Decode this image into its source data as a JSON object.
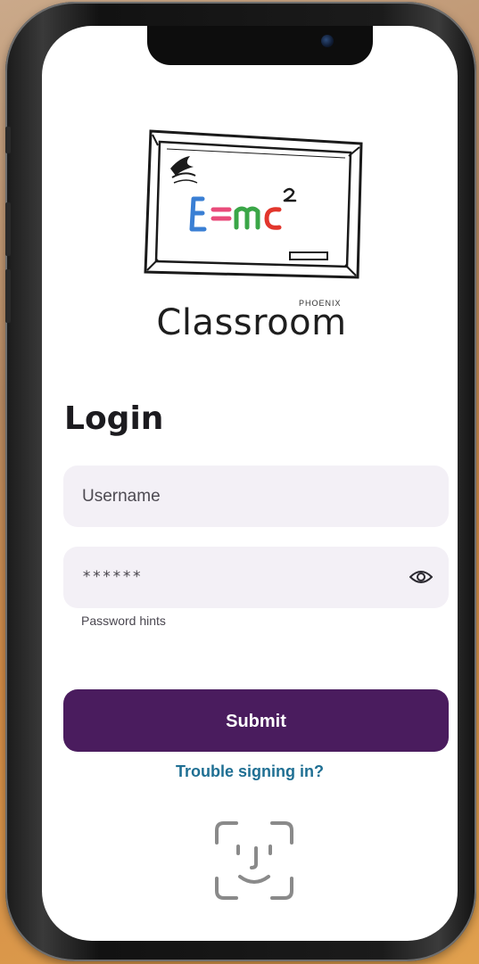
{
  "app": {
    "logo_word": "Classroom",
    "logo_sub": "PHOENIX",
    "equation": "E=mc"
  },
  "login": {
    "title": "Login",
    "username_placeholder": "Username",
    "password_mask": "******",
    "password_hint": "Password hints",
    "submit_label": "Submit",
    "trouble_link": "Trouble signing in?"
  },
  "icons": {
    "eye": "eye-icon",
    "face_id": "face-id-icon",
    "camera": "camera-dot"
  },
  "colors": {
    "primary_button": "#4a1c5e",
    "link": "#1f6f93",
    "field_bg": "#f3f0f6",
    "screen_bg": "#ffffff"
  }
}
